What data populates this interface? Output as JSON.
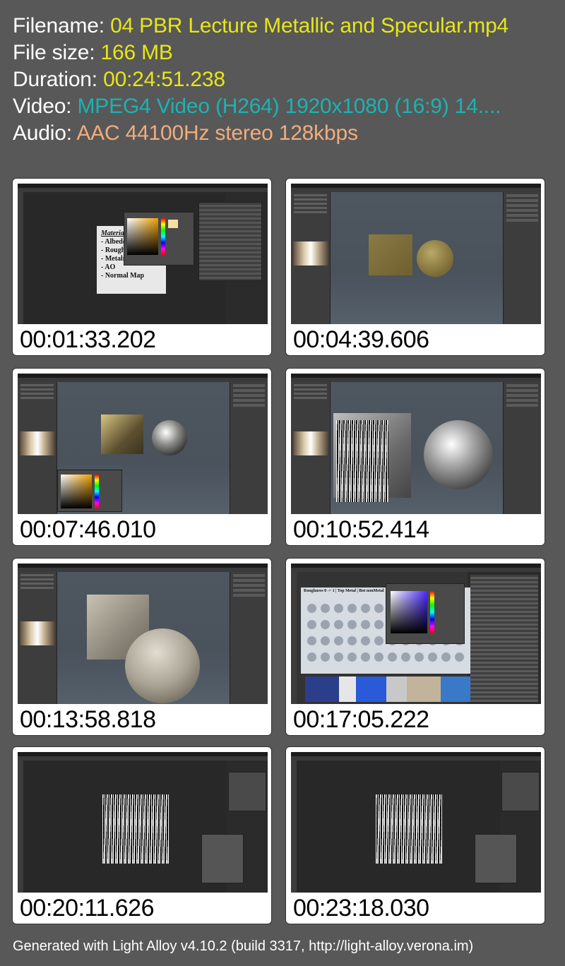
{
  "info": {
    "filename_label": "Filename:",
    "filename": "04 PBR Lecture Metallic and Specular.mp4",
    "filesize_label": "File size:",
    "filesize": "166 MB",
    "duration_label": "Duration:",
    "duration": "00:24:51.238",
    "video_label": "Video:",
    "video": "MPEG4 Video (H264) 1920x1080 (16:9) 14....",
    "audio_label": "Audio:",
    "audio": "AAC 44100Hz stereo 128kbps"
  },
  "colors": {
    "background": "#585858",
    "value_yellow": "#e6e619",
    "value_teal": "#1bb3b3",
    "value_orange": "#f0ad7e"
  },
  "thumbnails": [
    {
      "timestamp": "00:01:33.202",
      "slide_title": "Materia",
      "slide_items": [
        "- Albedo",
        "- Rough",
        "- Metaln",
        "- AO",
        "- Normal Map"
      ]
    },
    {
      "timestamp": "00:04:39.606"
    },
    {
      "timestamp": "00:07:46.010"
    },
    {
      "timestamp": "00:10:52.414"
    },
    {
      "timestamp": "00:13:58.818"
    },
    {
      "timestamp": "00:17:05.222",
      "slide_title": "Roughness 0 -> 1 | Top Metal | Bot nonMetal"
    },
    {
      "timestamp": "00:20:11.626"
    },
    {
      "timestamp": "00:23:18.030"
    }
  ],
  "footer": "Generated with Light Alloy v4.10.2 (build 3317, http://light-alloy.verona.im)"
}
